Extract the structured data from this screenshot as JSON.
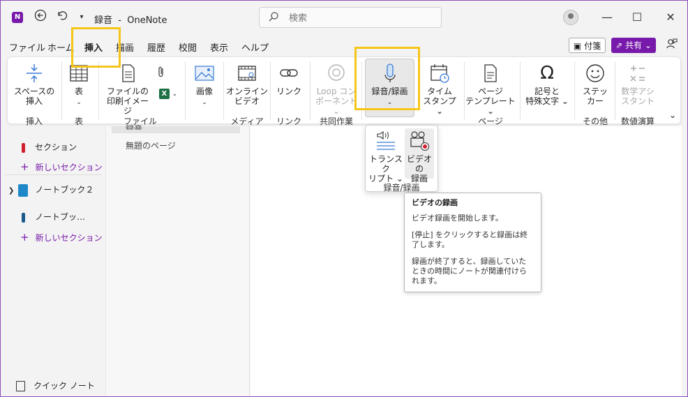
{
  "window": {
    "title": "録音  -  OneNote",
    "logo_text": "N"
  },
  "titlebar": {
    "back_icon": "back-arrow-icon",
    "undo_icon": "undo-icon",
    "qat_icon": "chevron-down-icon",
    "search_placeholder": "検索",
    "minimize": "—",
    "maximize": "☐",
    "close": "✕"
  },
  "tabs": [
    {
      "label": "ファイル"
    },
    {
      "label": "ホーム"
    },
    {
      "label": "挿入",
      "active": true
    },
    {
      "label": "描画"
    },
    {
      "label": "履歴"
    },
    {
      "label": "校閲"
    },
    {
      "label": "表示"
    },
    {
      "label": "ヘルプ"
    }
  ],
  "header_buttons": {
    "fusen": "付箋",
    "share": "共有 ⌄"
  },
  "ribbon": {
    "space": {
      "l1": "スペースの",
      "l2": "挿入"
    },
    "table": {
      "l1": "表",
      "l2": "⌄"
    },
    "printout": {
      "l1": "ファイルの",
      "l2": "印刷イメージ"
    },
    "attach_chevron": "⌄",
    "picture": {
      "l1": "画像",
      "l2": "⌄"
    },
    "online_video": {
      "l1": "オンライン",
      "l2": "ビデオ"
    },
    "link": {
      "l1": "リンク"
    },
    "loop": {
      "l1": "Loop コン",
      "l2": "ポーネント ⌄"
    },
    "recording": {
      "l1": "録音/録画",
      "l2": "⌄"
    },
    "timestamp": {
      "l1": "タイム",
      "l2": "スタンプ ⌄"
    },
    "page_template": {
      "l1": "ページ",
      "l2": "テンプレート ⌄"
    },
    "symbols": {
      "l1": "記号と",
      "l2": "特殊文字 ⌄"
    },
    "sticker": {
      "l1": "ステッ",
      "l2": "カー"
    },
    "math": {
      "l1": "数学アシ",
      "l2": "スタント"
    },
    "groups": {
      "insert": "挿入",
      "table": "表",
      "file": "ファイル",
      "image": "画像",
      "media": "メディア",
      "link": "リンク",
      "collab": "共同作業",
      "page": "ページ",
      "other": "その他",
      "math": "数値演算"
    },
    "expand_icon": "⌄"
  },
  "nav": {
    "items": [
      {
        "label": "セクション"
      },
      {
        "label": "新しいセクション"
      },
      {
        "label": "ノートブック２"
      },
      {
        "label": "ノートブッ…"
      },
      {
        "label": "新しいセクション"
      }
    ],
    "quick_notes": "クイック ノート"
  },
  "pages": {
    "current": "録音",
    "untitled": "無題のページ"
  },
  "dropdown": {
    "transcribe": {
      "l1": "トランスク",
      "l2": "リプト ⌄"
    },
    "video": {
      "l1": "ビデオの",
      "l2": "録画"
    },
    "label": "録音/録画"
  },
  "tooltip": {
    "title": "ビデオの録画",
    "p1": "ビデオ録画を開始します。",
    "p2": "[停止] をクリックすると録画は終了します。",
    "p3": "録画が終了すると、録画していたときの時間にノートが関連付けられます。"
  },
  "colors": {
    "accent": "#7719aa",
    "highlight": "#f5c518"
  }
}
